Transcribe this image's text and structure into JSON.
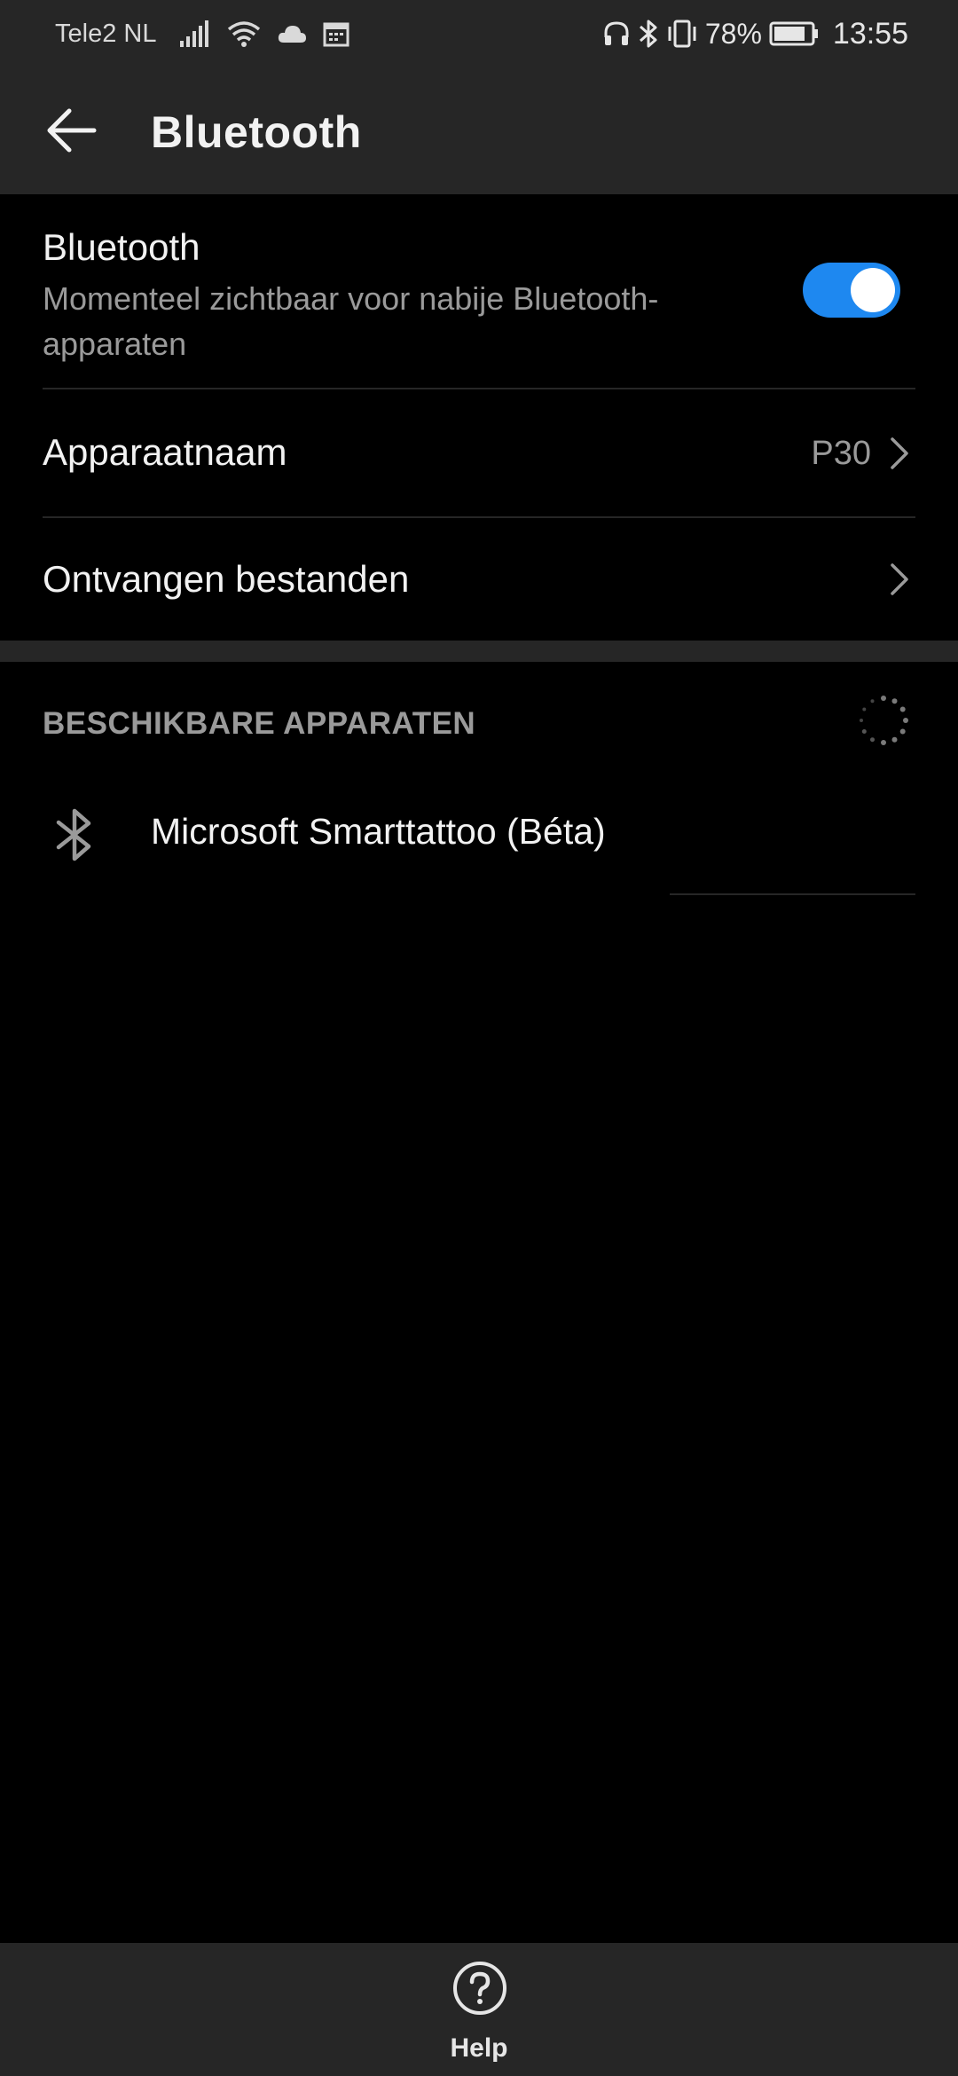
{
  "status_bar": {
    "carrier": "Tele2 NL",
    "battery_percent": "78%",
    "time": "13:55",
    "icons": [
      "signal-icon",
      "wifi-icon",
      "cloud-icon",
      "calendar-icon",
      "headphones-icon",
      "bluetooth-icon",
      "vibrate-icon",
      "battery-icon"
    ]
  },
  "app_bar": {
    "title": "Bluetooth",
    "back_icon": "arrow-left-icon"
  },
  "bluetooth_toggle": {
    "title": "Bluetooth",
    "subtitle": "Momenteel zichtbaar voor nabije Bluetooth-apparaten",
    "enabled": true,
    "accent_color": "#1e88f0"
  },
  "device_name_row": {
    "label": "Apparaatnaam",
    "value": "P30"
  },
  "received_files_row": {
    "label": "Ontvangen bestanden"
  },
  "available_devices": {
    "header": "BESCHIKBARE APPARATEN",
    "scanning": true,
    "devices": [
      {
        "name": "Microsoft Smarttattoo (Béta)",
        "icon": "bluetooth-icon"
      }
    ]
  },
  "bottom_bar": {
    "help_label": "Help",
    "help_icon": "help-circle-icon"
  },
  "colors": {
    "background": "#000000",
    "bar_background": "#262626",
    "primary_text": "#f2f2f2",
    "secondary_text": "#9a9a9a"
  }
}
